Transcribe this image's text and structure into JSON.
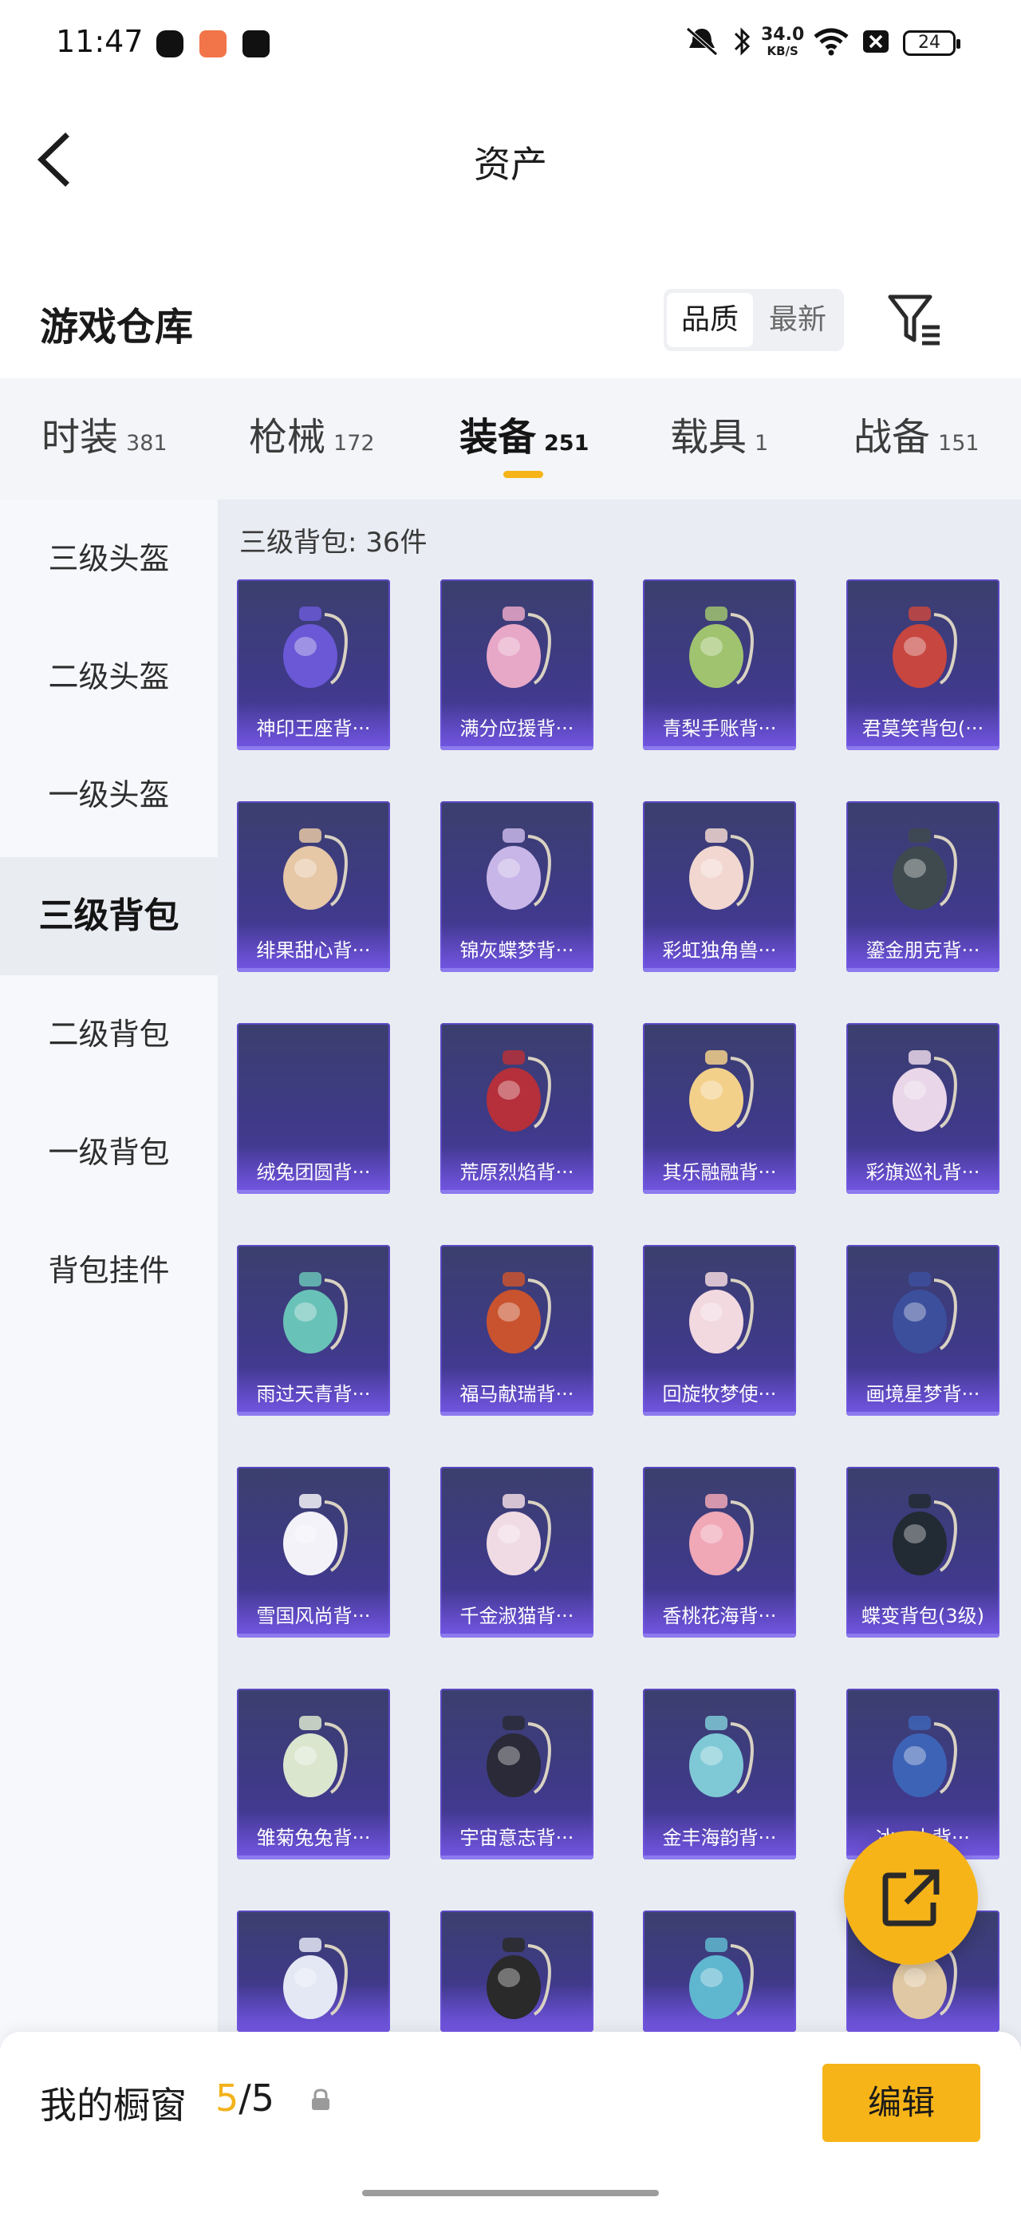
{
  "status_bar": {
    "time": "11:47",
    "speed_value": "34.0",
    "speed_unit": "KB/S",
    "battery": "24",
    "icons": [
      "shield-app-icon",
      "orange-app-icon",
      "tiktok-icon",
      "mute-bell-icon",
      "bluetooth-icon",
      "wifi-icon",
      "x-box-icon"
    ]
  },
  "nav": {
    "title": "资产",
    "back_icon": "chevron-left-icon"
  },
  "section": {
    "title": "游戏仓库",
    "sort_options": [
      "品质",
      "最新"
    ],
    "selected_sort": "品质",
    "filter_icon": "filter-list-icon"
  },
  "tabs": [
    {
      "label": "时装",
      "count": "381"
    },
    {
      "label": "枪械",
      "count": "172"
    },
    {
      "label": "装备",
      "count": "251",
      "active": true
    },
    {
      "label": "载具",
      "count": "1"
    },
    {
      "label": "战备",
      "count": "151"
    }
  ],
  "sidebar": [
    {
      "label": "三级头盔"
    },
    {
      "label": "二级头盔"
    },
    {
      "label": "一级头盔"
    },
    {
      "label": "三级背包",
      "active": true
    },
    {
      "label": "二级背包"
    },
    {
      "label": "一级背包"
    },
    {
      "label": "背包挂件"
    }
  ],
  "category_label": "三级背包: 36件",
  "items": [
    {
      "name": "神印王座背···",
      "color": "#6a58d6"
    },
    {
      "name": "满分应援背···",
      "color": "#e7a7c7"
    },
    {
      "name": "青梨手账背···",
      "color": "#9fc36e"
    },
    {
      "name": "君莫笑背包(···",
      "color": "#c7463f"
    },
    {
      "name": "绯果甜心背···",
      "color": "#e6c7a6"
    },
    {
      "name": "锦灰蝶梦背···",
      "color": "#c8b6e8"
    },
    {
      "name": "彩虹独角兽···",
      "color": "#f1d7d0"
    },
    {
      "name": "鎏金朋克背···",
      "color": "#3e4a4e"
    },
    {
      "name": "绒兔团圆背···",
      "color": ""
    },
    {
      "name": "荒原烈焰背···",
      "color": "#b5303a"
    },
    {
      "name": "其乐融融背···",
      "color": "#f3d08a"
    },
    {
      "name": "彩旗巡礼背···",
      "color": "#e9d6e8"
    },
    {
      "name": "雨过天青背···",
      "color": "#69c2b7"
    },
    {
      "name": "福马献瑞背···",
      "color": "#c9532f"
    },
    {
      "name": "回旋牧梦使···",
      "color": "#f2d8df"
    },
    {
      "name": "画境星梦背···",
      "color": "#3c4f9c"
    },
    {
      "name": "雪国风尚背···",
      "color": "#f3f2f8"
    },
    {
      "name": "千金淑猫背···",
      "color": "#f0dbe4"
    },
    {
      "name": "香桃花海背···",
      "color": "#f0a7b6"
    },
    {
      "name": "蝶变背包(3级)",
      "color": "#222a33"
    },
    {
      "name": "雏菊兔兔背···",
      "color": "#dbe6cf"
    },
    {
      "name": "宇宙意志背···",
      "color": "#2a2a38"
    },
    {
      "name": "金丰海韵背···",
      "color": "#7fc9d6"
    },
    {
      "name": "冰···士背···",
      "color": "#3d63b6"
    },
    {
      "name": "",
      "color": "#e4e8f4"
    },
    {
      "name": "",
      "color": "#2a2a2a"
    },
    {
      "name": "",
      "color": "#5fb7cf"
    },
    {
      "name": "",
      "color": "#e0c8a4"
    }
  ],
  "fab_icon": "external-share-icon",
  "bottom_bar": {
    "label": "我的橱窗",
    "count_current": "5",
    "count_sep": "/",
    "count_total": "5",
    "lock_icon": "lock-icon",
    "edit_label": "编辑"
  }
}
